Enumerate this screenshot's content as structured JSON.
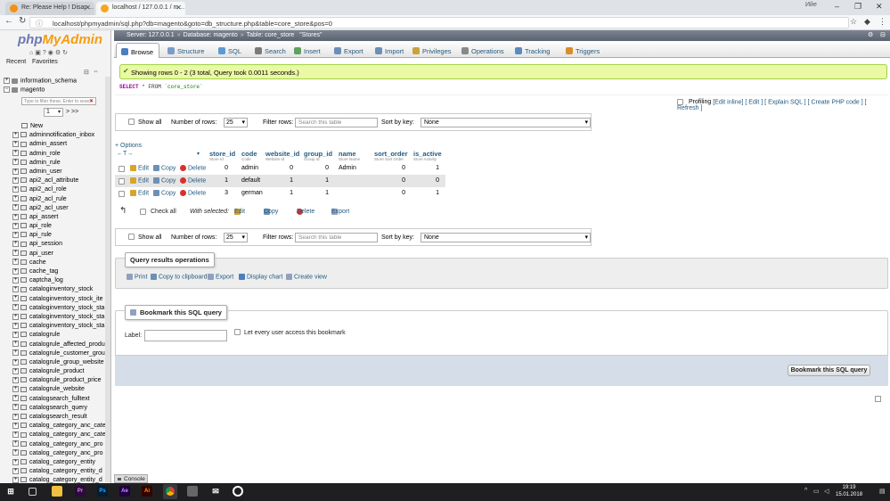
{
  "browser": {
    "tabs": [
      {
        "title": "Re: Please Help ! Disap…"
      },
      {
        "title": "localhost / 127.0.0.1 / m…"
      }
    ],
    "url": "localhost/phpmyadmin/sql.php?db=magento&goto=db_structure.php&table=core_store&pos=0",
    "user_label": "Ийе"
  },
  "nav": {
    "logo_a": "php",
    "logo_b": "MyAdmin",
    "recent": "Recent",
    "favorites": "Favorites",
    "dbs": [
      "information_schema",
      "magento"
    ],
    "filter_placeholder": "Type to filter these, Enter to search",
    "page": "1",
    "page_next": "> >>",
    "new_label": "New",
    "tables": [
      "adminnotification_inbox",
      "admin_assert",
      "admin_role",
      "admin_rule",
      "admin_user",
      "api2_acl_attribute",
      "api2_acl_role",
      "api2_acl_rule",
      "api2_acl_user",
      "api_assert",
      "api_role",
      "api_rule",
      "api_session",
      "api_user",
      "cache",
      "cache_tag",
      "captcha_log",
      "cataloginventory_stock",
      "cataloginventory_stock_ite",
      "cataloginventory_stock_sta",
      "cataloginventory_stock_sta",
      "cataloginventory_stock_sta",
      "catalogrule",
      "catalogrule_affected_produ",
      "catalogrule_customer_grou",
      "catalogrule_group_website",
      "catalogrule_product",
      "catalogrule_product_price",
      "catalogrule_website",
      "catalogsearch_fulltext",
      "catalogsearch_query",
      "catalogsearch_result",
      "catalog_category_anc_cate",
      "catalog_category_anc_cate",
      "catalog_category_anc_pro",
      "catalog_category_anc_pro",
      "catalog_category_entity",
      "catalog_category_entity_d",
      "catalog_category_entity_d"
    ]
  },
  "breadcrumb": {
    "server": "Server: 127.0.0.1",
    "database": "Database: magento",
    "table": "Table: core_store",
    "comment": "\"Stores\""
  },
  "menu": [
    "Browse",
    "Structure",
    "SQL",
    "Search",
    "Insert",
    "Export",
    "Import",
    "Privileges",
    "Operations",
    "Tracking",
    "Triggers"
  ],
  "success": "Showing rows 0 - 2 (3 total, Query took 0.0011 seconds.)",
  "sql": {
    "kw1": "SELECT",
    "rest": " * FROM ",
    "str": "`core_store`"
  },
  "profiling": {
    "label": "Profiling",
    "links": "[Edit inline] [ Edit ] [ Explain SQL ] [ Create PHP code ] [ Refresh ]"
  },
  "nav_controls": {
    "show_all": "Show all",
    "num_rows_label": "Number of rows:",
    "num_rows": "25",
    "filter_label": "Filter rows:",
    "filter_placeholder": "Search this table",
    "sort_label": "Sort by key:",
    "sort_value": "None"
  },
  "options": "+ Options",
  "arrows": "←T→",
  "columns": [
    {
      "name": "store_id",
      "sub": "Store Id"
    },
    {
      "name": "code",
      "sub": "Code"
    },
    {
      "name": "website_id",
      "sub": "Website Id"
    },
    {
      "name": "group_id",
      "sub": "Group Id"
    },
    {
      "name": "name",
      "sub": "Store Name"
    },
    {
      "name": "sort_order",
      "sub": "Store Sort Order"
    },
    {
      "name": "is_active",
      "sub": "Store Activity"
    }
  ],
  "row_actions": {
    "edit": "Edit",
    "copy": "Copy",
    "delete": "Delete"
  },
  "rows": [
    [
      "0",
      "admin",
      "0",
      "0",
      "Admin",
      "0",
      "1"
    ],
    [
      "1",
      "default",
      "1",
      "1",
      "",
      "0",
      "0"
    ],
    [
      "3",
      "german",
      "1",
      "1",
      "",
      "0",
      "1"
    ]
  ],
  "with_selected": {
    "check_all": "Check all",
    "label": "With selected:",
    "edit": "Edit",
    "copy": "Copy",
    "delete": "Delete",
    "export": "Export"
  },
  "query_ops": {
    "legend": "Query results operations",
    "print": "Print",
    "copy_clip": "Copy to clipboard",
    "export": "Export",
    "chart": "Display chart",
    "view": "Create view"
  },
  "bookmark": {
    "legend": "Bookmark this SQL query",
    "label": "Label:",
    "every_user": "Let every user access this bookmark",
    "button": "Bookmark this SQL query"
  },
  "console": "Console",
  "clock": {
    "time": "19:19",
    "date": "15.01.2018"
  }
}
